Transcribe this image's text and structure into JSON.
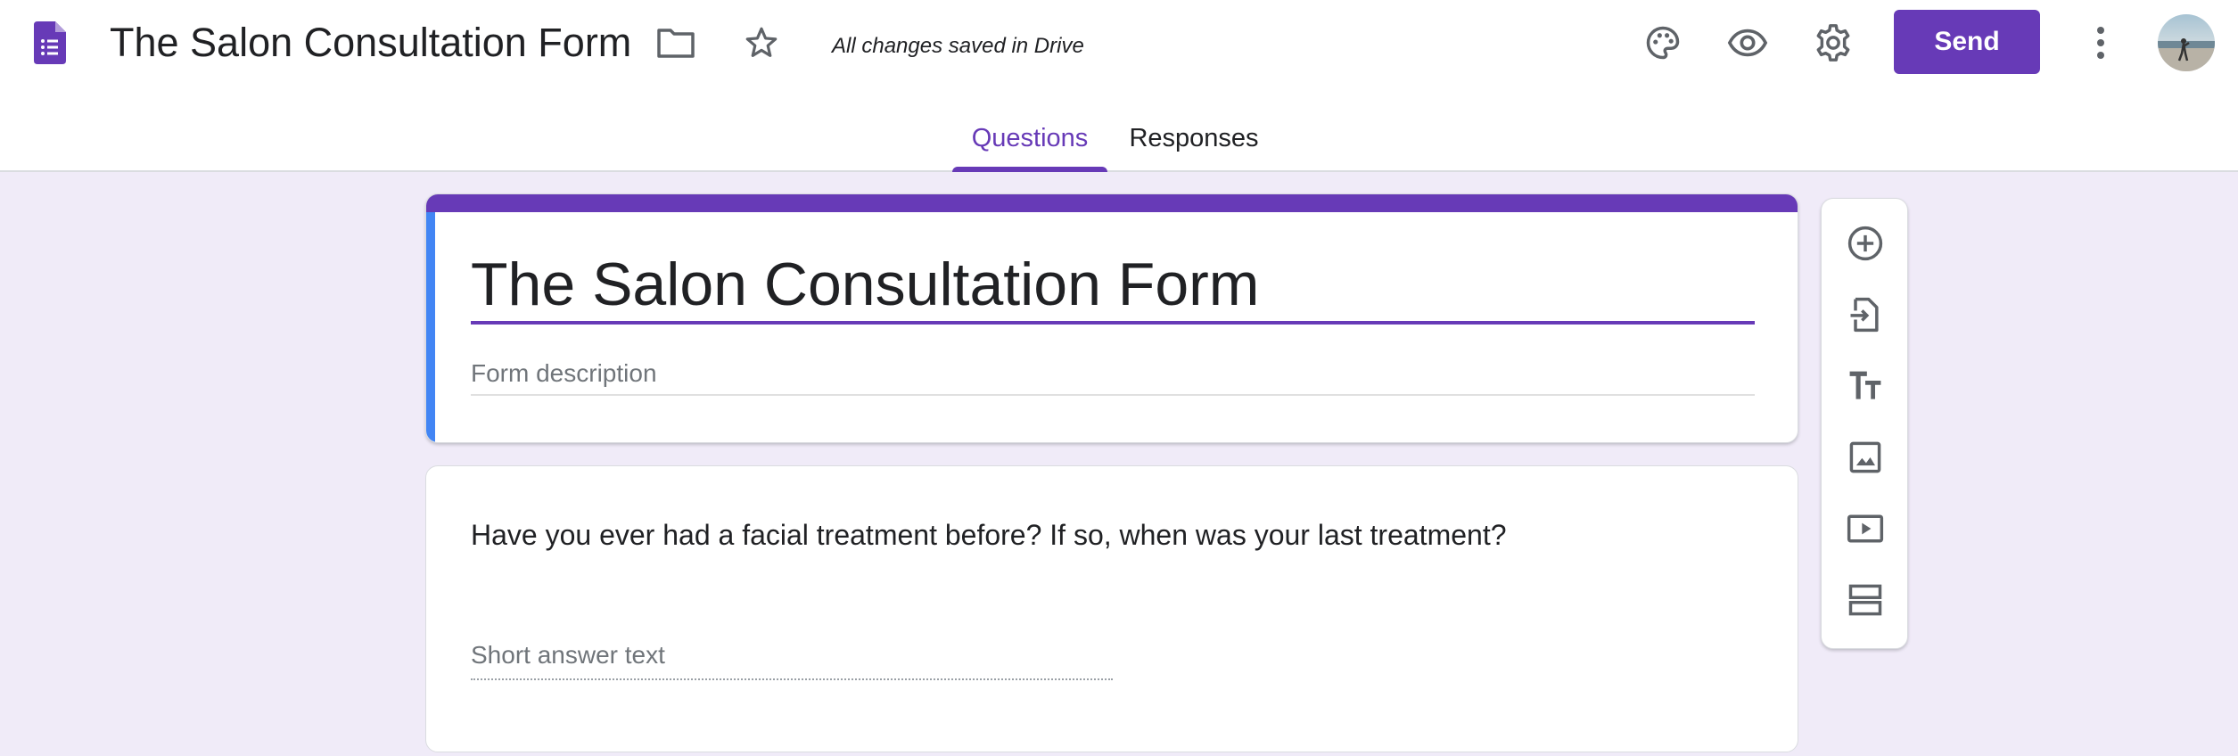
{
  "header": {
    "logo_icon": "google-forms-icon",
    "title": "The Salon Consultation Form",
    "folder_icon": "folder-icon",
    "star_icon": "star-icon",
    "save_status": "All changes saved in Drive",
    "palette_icon": "palette-icon",
    "preview_icon": "eye-icon",
    "settings_icon": "gear-icon",
    "send_label": "Send",
    "more_icon": "more-vert-icon",
    "avatar": "avatar"
  },
  "tabs": [
    {
      "label": "Questions",
      "active": true
    },
    {
      "label": "Responses",
      "active": false
    }
  ],
  "form": {
    "title": "The Salon Consultation Form",
    "description_placeholder": "Form description"
  },
  "questions": [
    {
      "text": "Have you ever had a facial treatment before? If so, when was your last treatment?",
      "answer_placeholder": "Short answer text"
    }
  ],
  "toolbar": {
    "items": [
      "add-question-icon",
      "import-questions-icon",
      "add-title-icon",
      "add-image-icon",
      "add-video-icon",
      "add-section-icon"
    ]
  },
  "colors": {
    "accent": "#673ab7",
    "background": "#f0ebf8",
    "left_band": "#4285f4"
  }
}
